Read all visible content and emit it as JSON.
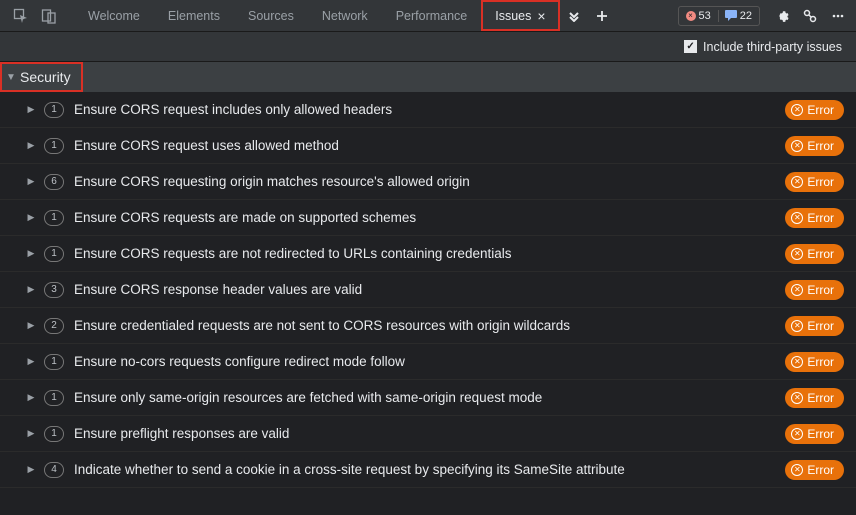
{
  "tabs": [
    {
      "label": "Welcome"
    },
    {
      "label": "Elements"
    },
    {
      "label": "Sources"
    },
    {
      "label": "Network"
    },
    {
      "label": "Performance"
    },
    {
      "label": "Issues",
      "active": true,
      "closable": true
    }
  ],
  "counts": {
    "errors": "53",
    "info": "22"
  },
  "filter": {
    "include_third_party_label": "Include third-party issues",
    "checked": true
  },
  "section": {
    "title": "Security"
  },
  "badge": {
    "error_label": "Error"
  },
  "issues": [
    {
      "count": "1",
      "text": "Ensure CORS request includes only allowed headers"
    },
    {
      "count": "1",
      "text": "Ensure CORS request uses allowed method"
    },
    {
      "count": "6",
      "text": "Ensure CORS requesting origin matches resource's allowed origin"
    },
    {
      "count": "1",
      "text": "Ensure CORS requests are made on supported schemes"
    },
    {
      "count": "1",
      "text": "Ensure CORS requests are not redirected to URLs containing credentials"
    },
    {
      "count": "3",
      "text": "Ensure CORS response header values are valid"
    },
    {
      "count": "2",
      "text": "Ensure credentialed requests are not sent to CORS resources with origin wildcards"
    },
    {
      "count": "1",
      "text": "Ensure no-cors requests configure redirect mode follow"
    },
    {
      "count": "1",
      "text": "Ensure only same-origin resources are fetched with same-origin request mode"
    },
    {
      "count": "1",
      "text": "Ensure preflight responses are valid"
    },
    {
      "count": "4",
      "text": "Indicate whether to send a cookie in a cross-site request by specifying its SameSite attribute"
    }
  ]
}
